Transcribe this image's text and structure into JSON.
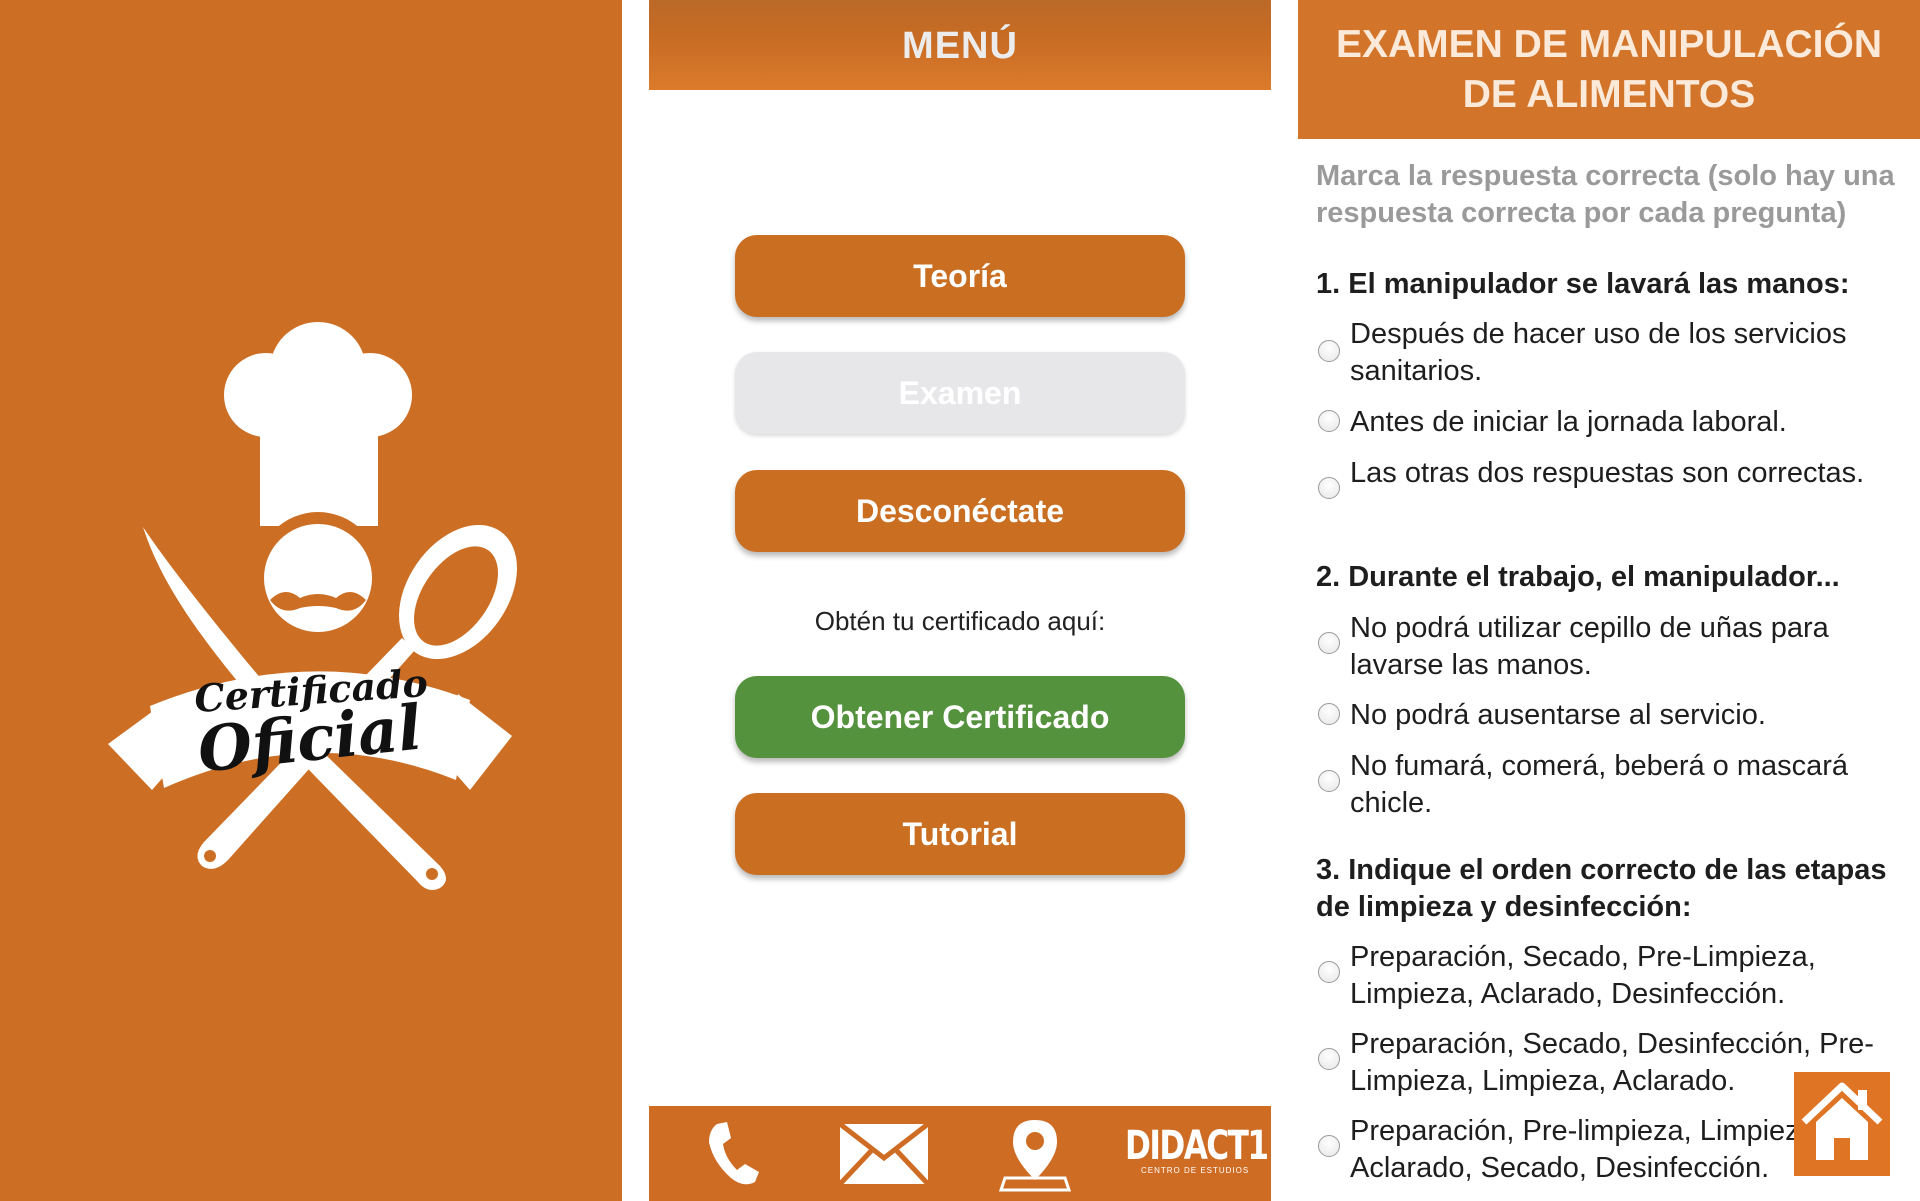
{
  "colors": {
    "brand_orange": "#cc6f25",
    "green": "#54923d",
    "disabled": "#e7e7e9"
  },
  "splash": {
    "logo_line1": "Certificado",
    "logo_line2": "Oficial"
  },
  "menu": {
    "title": "MENÚ",
    "buttons": {
      "teoria": "Teoría",
      "examen": "Examen",
      "desconectate": "Desconéctate",
      "obtener": "Obtener Certificado",
      "tutorial": "Tutorial"
    },
    "cert_prompt": "Obtén tu certificado aquí:",
    "footer": {
      "icons": [
        "phone-icon",
        "mail-icon",
        "location-pin-icon"
      ],
      "brand_name": "DIDACT1",
      "brand_sub": "CENTRO DE ESTUDIOS"
    }
  },
  "exam": {
    "title_line1": "EXAMEN DE MANIPULACIÓN",
    "title_line2": "DE ALIMENTOS",
    "instructions": "Marca la respuesta correcta (solo hay una respuesta correcta por cada pregunta)",
    "questions": [
      {
        "text": "1. El manipulador se lavará las manos:",
        "options": [
          "Después de hacer uso de los servicios sanitarios.",
          "Antes de iniciar la jornada laboral.",
          "Las otras dos respuestas son correctas."
        ]
      },
      {
        "text": "2. Durante el trabajo, el manipulador...",
        "options": [
          "No podrá utilizar cepillo de uñas para lavarse las manos.",
          "No podrá ausentarse al servicio.",
          "No fumará, comerá, beberá o mascará chicle."
        ]
      },
      {
        "text": "3. Indique el orden correcto de las etapas de limpieza y desinfección:",
        "options": [
          "Preparación, Secado, Pre-Limpieza, Limpieza, Aclarado, Desinfección.",
          "Preparación, Secado, Desinfección, Pre-Limpieza, Limpieza, Aclarado.",
          "Preparación, Pre-limpieza, Limpieza, Aclarado, Secado, Desinfección."
        ]
      }
    ],
    "home_icon": "home-icon"
  }
}
